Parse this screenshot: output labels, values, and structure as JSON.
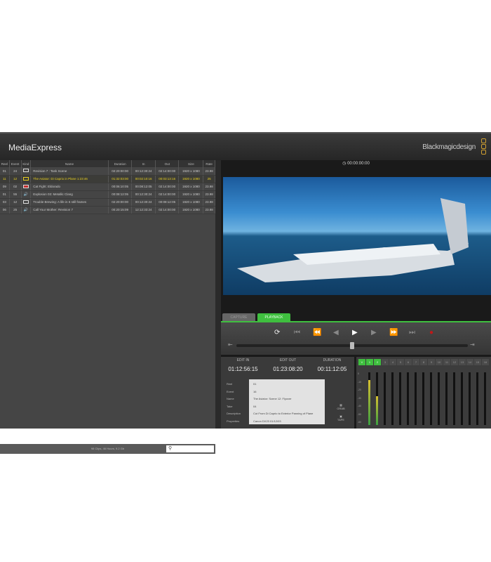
{
  "app": {
    "title": "MediaExpress",
    "brand": "Blackmagicdesign"
  },
  "clips": {
    "headers": [
      "Reel",
      "Event",
      "Kind",
      "Name",
      "Duration",
      "In",
      "Out",
      "Size",
      "Rate"
    ],
    "rows": [
      {
        "reel": "01",
        "event": "24",
        "kind": "video",
        "name": "Revision 7 : Tank Scene",
        "duration": "02:20:00:00",
        "in": "00:12:30:24",
        "out": "02:14:00:00",
        "size": "1920 x 1080",
        "rate": "23.98",
        "selected": false
      },
      {
        "reel": "11",
        "event": "12",
        "kind": "video",
        "name": "The Aviator: Di Caprio in Plane 1:23:46",
        "duration": "01:32:03:00",
        "in": "00:02:10:16",
        "out": "00:03:13:16",
        "size": "1920 x 1080",
        "rate": "25",
        "selected": true
      },
      {
        "reel": "09",
        "event": "02",
        "kind": "video-red",
        "name": "Cat Fight: Eldorado",
        "duration": "00:06:10:05",
        "in": "00:08:12:05",
        "out": "02:14:00:00",
        "size": "1920 x 1080",
        "rate": "23.98",
        "selected": false
      },
      {
        "reel": "01",
        "event": "55",
        "kind": "audio",
        "name": "Explosion 03: Metallic Clang",
        "duration": "00:08:12:05",
        "in": "00:12:30:24",
        "out": "02:14:00:00",
        "size": "1920 x 1080",
        "rate": "23.98",
        "selected": false
      },
      {
        "reel": "03",
        "event": "12",
        "kind": "video",
        "name": "Trouble Brewing: A life in 6 still frames",
        "duration": "02:20:00:00",
        "in": "00:12:30:24",
        "out": "00:08:12:05",
        "size": "1920 x 1080",
        "rate": "23.98",
        "selected": false
      },
      {
        "reel": "06",
        "event": "25",
        "kind": "audio",
        "name": "Call Your Mother: Revision 7",
        "duration": "00:20:15:09",
        "in": "12:12:33:24",
        "out": "02:14:00:00",
        "size": "1920 x 1080",
        "rate": "23.98",
        "selected": false
      }
    ],
    "status": "98 Clips, 46 Hours, 9.2 Gb"
  },
  "player": {
    "timecode": "00:00:00:00",
    "tabs": [
      "CAPTURE",
      "PLAYBACK"
    ],
    "scrub_position": 0.5
  },
  "edit": {
    "headers": [
      "EDIT IN",
      "EDIT OUT",
      "DURATION"
    ],
    "edit_in": "01:12:56:15",
    "edit_out": "01:23:08:20",
    "duration": "00:11:12:05",
    "props": [
      {
        "label": "Reel",
        "value": "01"
      },
      {
        "label": "Event",
        "value": "16"
      },
      {
        "label": "Name",
        "value": "The Aviator: Scene 12: Flyover"
      },
      {
        "label": "Take",
        "value": "04"
      },
      {
        "label": "Description",
        "value": "Cut From Di Caprio to Exterior Panning of Plane"
      },
      {
        "label": "Properties",
        "value": "Canon DX23 01/12/03"
      }
    ],
    "grab": "GRAB",
    "tape": "TAPE"
  },
  "meters": {
    "channels": [
      "V",
      "1",
      "2",
      "3",
      "4",
      "5",
      "6",
      "7",
      "8",
      "9",
      "10",
      "11",
      "12",
      "13",
      "14",
      "15",
      "16"
    ],
    "scale": [
      "0",
      "-10",
      "-20",
      "-30",
      "-40",
      "-50",
      "-60"
    ],
    "levels": [
      0.85,
      0.55
    ]
  },
  "colors": {
    "accent": "#3fbf3f",
    "selected": "#e8d020"
  }
}
